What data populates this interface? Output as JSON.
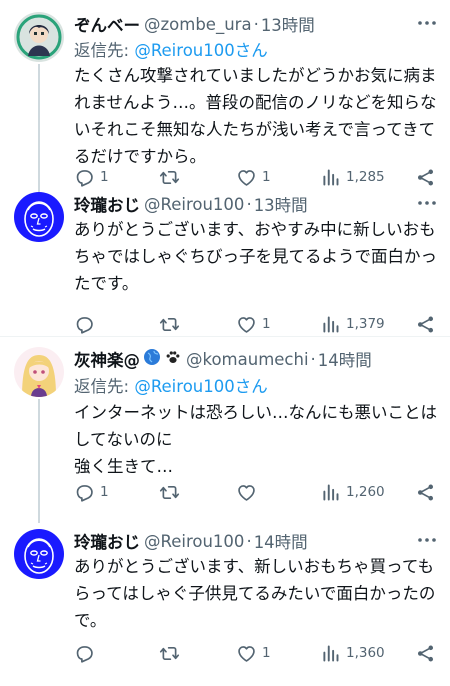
{
  "tweets": [
    {
      "name": "ぞんベー",
      "handle": "@zombe_ura",
      "time": "13時間",
      "reply_prefix": "返信先: ",
      "reply_to": "@Reirou100さん",
      "text": "たくさん攻撃されていましたがどうかお気に病まれませんよう…。普段の配信のノリなどを知らないそれこそ無知な人たちが浅い考えで言ってきてるだけですから。",
      "replies": "1",
      "retweets": "",
      "likes": "1",
      "views": "1,285",
      "avatar": "anime-character-avatar"
    },
    {
      "name": "玲瓏おじ",
      "handle": "@Reirou100",
      "time": "13時間",
      "text": "ありがとうございます、おやすみ中に新しいおもちゃではしゃぐちびっ子を見てるようで面白かったです。",
      "replies": "",
      "retweets": "",
      "likes": "1",
      "views": "1,379",
      "avatar": "blue-face-avatar"
    },
    {
      "name": "灰神楽@",
      "emoji_desc": "globe and paw emoji",
      "handle": "@komaumechi",
      "time": "14時間",
      "reply_prefix": "返信先: ",
      "reply_to": "@Reirou100さん",
      "text": "インターネットは恐ろしい…なんにも悪いことはしてないのに\n強く生きて…",
      "replies": "1",
      "retweets": "",
      "likes": "",
      "views": "1,260",
      "avatar": "anime-girl-avatar"
    },
    {
      "name": "玲瓏おじ",
      "handle": "@Reirou100",
      "time": "14時間",
      "text": "ありがとうございます、新しいおもちゃ買ってもらってはしゃぐ子供見てるみたいで面白かったので。",
      "replies": "",
      "retweets": "",
      "likes": "1",
      "views": "1,360",
      "avatar": "blue-face-avatar"
    }
  ],
  "colors": {
    "text": "#0f1419",
    "muted": "#536471",
    "link": "#1d9bf0",
    "thread_line": "#cfd9de",
    "separator": "#eff3f4",
    "avatar_blue": "#1a1aff"
  }
}
